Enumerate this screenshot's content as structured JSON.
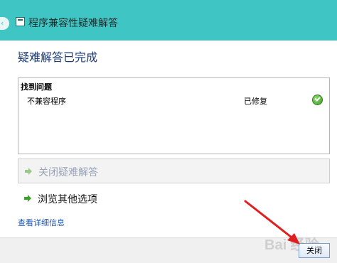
{
  "window": {
    "title": "程序兼容性疑难解答",
    "back_icon": "back-arrow-icon",
    "accent_color": "#3fc6c4"
  },
  "main": {
    "heading": "疑难解答已完成",
    "results": {
      "header": "找到问题",
      "issues": [
        {
          "name": "不兼容程序",
          "status": "已修复",
          "status_icon": "green-check-icon"
        }
      ]
    },
    "options": [
      {
        "label": "关闭疑难解答",
        "icon": "green-arrow-icon",
        "enabled": false
      },
      {
        "label": "浏览其他选项",
        "icon": "green-arrow-icon",
        "enabled": true
      }
    ],
    "details_link": "查看详细信息"
  },
  "footer": {
    "close_label": "关闭"
  },
  "overlay": {
    "watermark": "Bai 经验",
    "annotation_arrow_color": "#e02020"
  }
}
